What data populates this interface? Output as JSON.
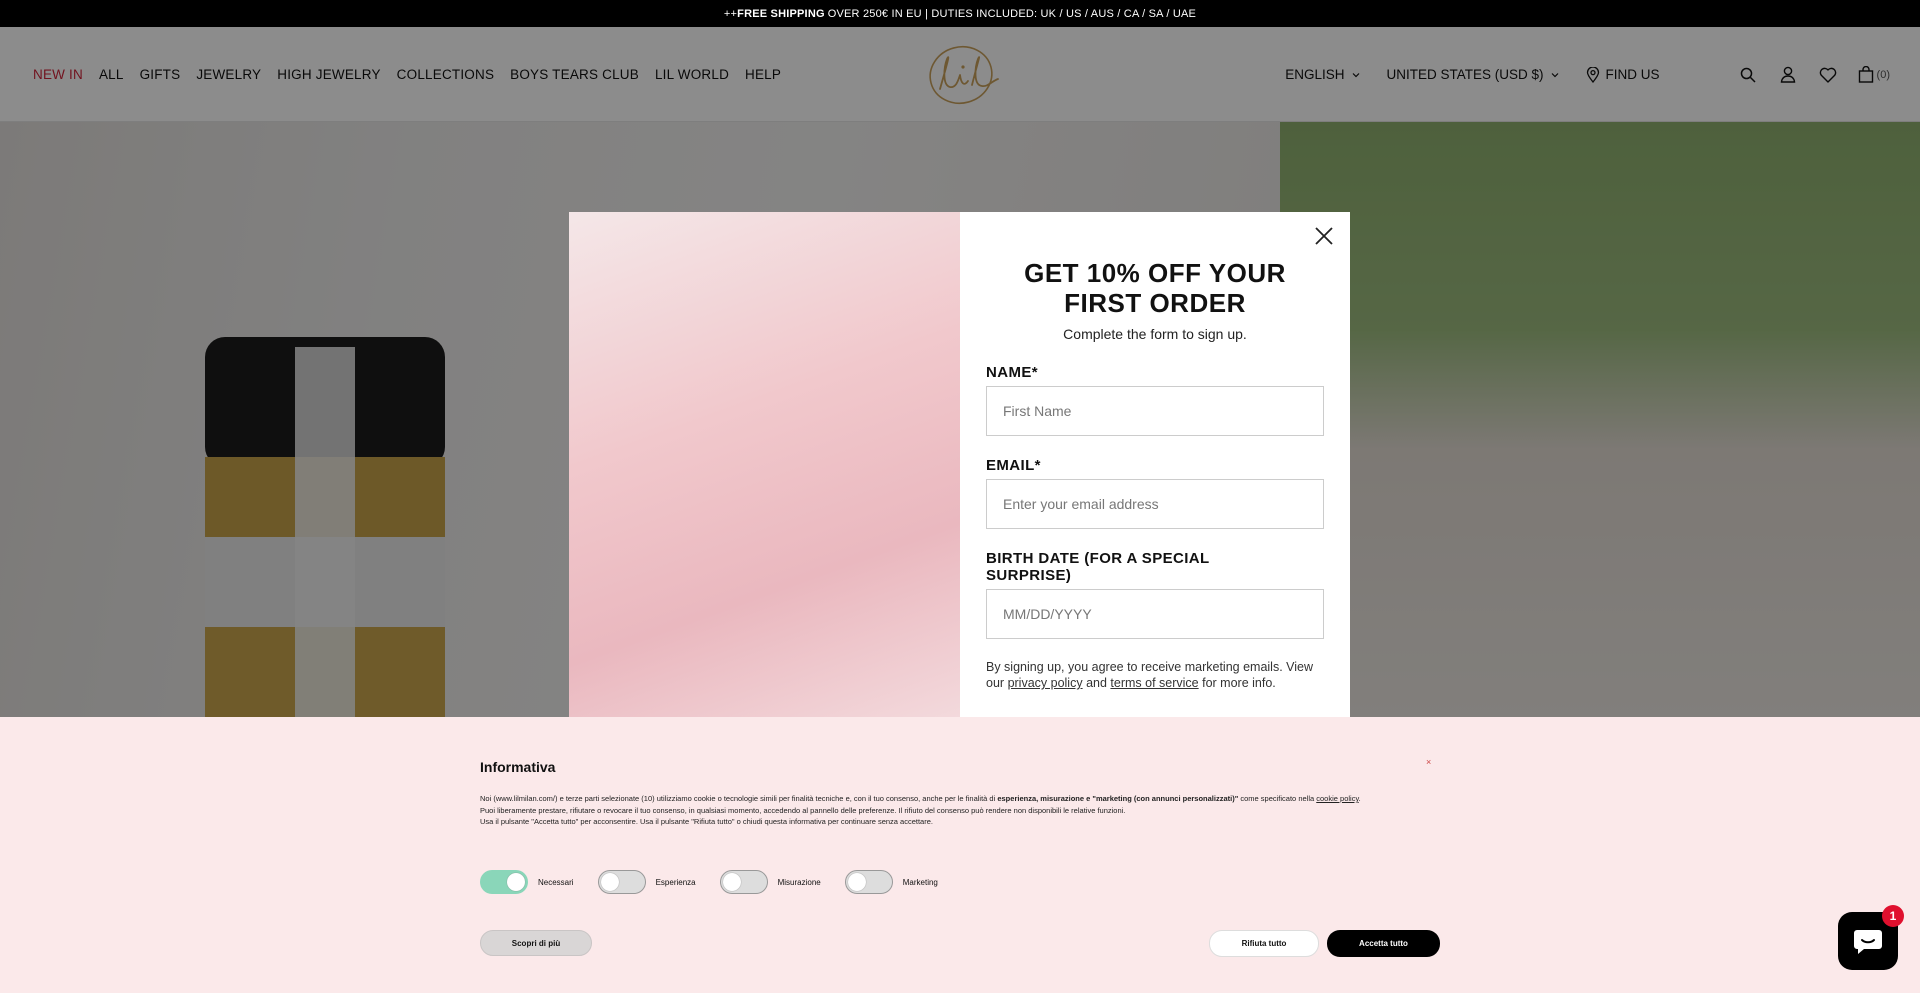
{
  "announcement": {
    "prefix": "++",
    "bold": "FREE SHIPPING",
    "rest": "OVER 250€ IN EU | DUTIES INCLUDED: UK / US / AUS / CA / SA / UAE"
  },
  "nav": {
    "items": [
      {
        "label": "NEW IN",
        "accent": "#d0243a"
      },
      {
        "label": "ALL"
      },
      {
        "label": "GIFTS"
      },
      {
        "label": "JEWELRY"
      },
      {
        "label": "HIGH JEWELRY"
      },
      {
        "label": "COLLECTIONS"
      },
      {
        "label": "BOYS TEARS CLUB"
      },
      {
        "label": "LIL WORLD"
      },
      {
        "label": "HELP"
      }
    ]
  },
  "header": {
    "logo_icon": "lil-logo",
    "language": "ENGLISH",
    "currency": "UNITED STATES (USD $)",
    "find_us": "FIND US",
    "cart_count": "(0)"
  },
  "popup": {
    "title": "GET 10% OFF YOUR FIRST ORDER",
    "subtitle": "Complete the form to sign up.",
    "name_label": "NAME*",
    "name_placeholder": "First Name",
    "email_label": "EMAIL*",
    "email_placeholder": "Enter your email address",
    "birth_label": "BIRTH DATE (FOR A SPECIAL SURPRISE)",
    "birth_placeholder": "MM/DD/YYYY",
    "note_prefix": "By signing up, you agree to receive marketing emails. View our",
    "privacy_link": "privacy policy",
    "and": "and",
    "terms_link": "terms of service",
    "note_suffix": "for more info."
  },
  "cookie": {
    "title": "Informativa",
    "close": "×",
    "line1_a": "Noi (www.lilmilan.com/) e terze parti selezionate (10) utilizziamo cookie o tecnologie simili per finalità tecniche e, con il tuo consenso, anche per le finalità di",
    "line1_bold": "esperienza, misurazione e \"marketing (con annunci personalizzati)\"",
    "line1_b": "come specificato nella",
    "line1_link": "cookie policy",
    "line2": "Puoi liberamente prestare, rifiutare o revocare il tuo consenso, in qualsiasi momento, accedendo al pannello delle preferenze. Il rifiuto del consenso può rendere non disponibili le relative funzioni.",
    "line3": "Usa il pulsante \"Accetta tutto\" per acconsentire. Usa il pulsante \"Rifiuta tutto\" o chiudi questa informativa per continuare senza accettare.",
    "toggles": [
      {
        "label": "Necessari",
        "on": true
      },
      {
        "label": "Esperienza",
        "on": false
      },
      {
        "label": "Misurazione",
        "on": false
      },
      {
        "label": "Marketing",
        "on": false
      }
    ],
    "more": "Scopri di più",
    "reject": "Rifiuta tutto",
    "accept": "Accetta tutto"
  },
  "chat": {
    "icon": "chat-bubble-icon",
    "badge": "1"
  }
}
